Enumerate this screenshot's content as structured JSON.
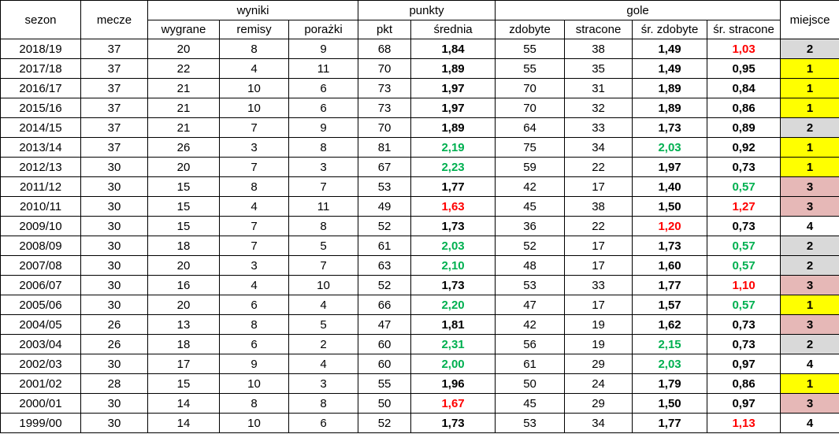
{
  "headers": {
    "sezon": "sezon",
    "mecze": "mecze",
    "wyniki": "wyniki",
    "punkty": "punkty",
    "gole": "gole",
    "miejsce": "miejsce",
    "wygrane": "wygrane",
    "remisy": "remisy",
    "porazki": "porażki",
    "pkt": "pkt",
    "srednia": "średnia",
    "zdobyte": "zdobyte",
    "stracone": "stracone",
    "sr_zdobyte": "śr. zdobyte",
    "sr_stracone": "śr. stracone"
  },
  "colors": {
    "green": "#00b050",
    "red": "#ff0000",
    "place_1": "#ffff00",
    "place_2": "#d9d9d9",
    "place_3": "#e6b8b7",
    "place_4": "#ffffff"
  },
  "rows": [
    {
      "sezon": "2018/19",
      "mecze": "37",
      "wygrane": "20",
      "remisy": "8",
      "porazki": "9",
      "pkt": "68",
      "srednia": "1,84",
      "srednia_color": "",
      "zdobyte": "55",
      "stracone": "38",
      "sr_zdobyte": "1,49",
      "sr_zdobyte_color": "",
      "sr_stracone": "1,03",
      "sr_stracone_color": "red",
      "miejsce": "2"
    },
    {
      "sezon": "2017/18",
      "mecze": "37",
      "wygrane": "22",
      "remisy": "4",
      "porazki": "11",
      "pkt": "70",
      "srednia": "1,89",
      "srednia_color": "",
      "zdobyte": "55",
      "stracone": "35",
      "sr_zdobyte": "1,49",
      "sr_zdobyte_color": "",
      "sr_stracone": "0,95",
      "sr_stracone_color": "",
      "miejsce": "1"
    },
    {
      "sezon": "2016/17",
      "mecze": "37",
      "wygrane": "21",
      "remisy": "10",
      "porazki": "6",
      "pkt": "73",
      "srednia": "1,97",
      "srednia_color": "",
      "zdobyte": "70",
      "stracone": "31",
      "sr_zdobyte": "1,89",
      "sr_zdobyte_color": "",
      "sr_stracone": "0,84",
      "sr_stracone_color": "",
      "miejsce": "1"
    },
    {
      "sezon": "2015/16",
      "mecze": "37",
      "wygrane": "21",
      "remisy": "10",
      "porazki": "6",
      "pkt": "73",
      "srednia": "1,97",
      "srednia_color": "",
      "zdobyte": "70",
      "stracone": "32",
      "sr_zdobyte": "1,89",
      "sr_zdobyte_color": "",
      "sr_stracone": "0,86",
      "sr_stracone_color": "",
      "miejsce": "1"
    },
    {
      "sezon": "2014/15",
      "mecze": "37",
      "wygrane": "21",
      "remisy": "7",
      "porazki": "9",
      "pkt": "70",
      "srednia": "1,89",
      "srednia_color": "",
      "zdobyte": "64",
      "stracone": "33",
      "sr_zdobyte": "1,73",
      "sr_zdobyte_color": "",
      "sr_stracone": "0,89",
      "sr_stracone_color": "",
      "miejsce": "2"
    },
    {
      "sezon": "2013/14",
      "mecze": "37",
      "wygrane": "26",
      "remisy": "3",
      "porazki": "8",
      "pkt": "81",
      "srednia": "2,19",
      "srednia_color": "green",
      "zdobyte": "75",
      "stracone": "34",
      "sr_zdobyte": "2,03",
      "sr_zdobyte_color": "green",
      "sr_stracone": "0,92",
      "sr_stracone_color": "",
      "miejsce": "1"
    },
    {
      "sezon": "2012/13",
      "mecze": "30",
      "wygrane": "20",
      "remisy": "7",
      "porazki": "3",
      "pkt": "67",
      "srednia": "2,23",
      "srednia_color": "green",
      "zdobyte": "59",
      "stracone": "22",
      "sr_zdobyte": "1,97",
      "sr_zdobyte_color": "",
      "sr_stracone": "0,73",
      "sr_stracone_color": "",
      "miejsce": "1"
    },
    {
      "sezon": "2011/12",
      "mecze": "30",
      "wygrane": "15",
      "remisy": "8",
      "porazki": "7",
      "pkt": "53",
      "srednia": "1,77",
      "srednia_color": "",
      "zdobyte": "42",
      "stracone": "17",
      "sr_zdobyte": "1,40",
      "sr_zdobyte_color": "",
      "sr_stracone": "0,57",
      "sr_stracone_color": "green",
      "miejsce": "3"
    },
    {
      "sezon": "2010/11",
      "mecze": "30",
      "wygrane": "15",
      "remisy": "4",
      "porazki": "11",
      "pkt": "49",
      "srednia": "1,63",
      "srednia_color": "red",
      "zdobyte": "45",
      "stracone": "38",
      "sr_zdobyte": "1,50",
      "sr_zdobyte_color": "",
      "sr_stracone": "1,27",
      "sr_stracone_color": "red",
      "miejsce": "3"
    },
    {
      "sezon": "2009/10",
      "mecze": "30",
      "wygrane": "15",
      "remisy": "7",
      "porazki": "8",
      "pkt": "52",
      "srednia": "1,73",
      "srednia_color": "",
      "zdobyte": "36",
      "stracone": "22",
      "sr_zdobyte": "1,20",
      "sr_zdobyte_color": "red",
      "sr_stracone": "0,73",
      "sr_stracone_color": "",
      "miejsce": "4"
    },
    {
      "sezon": "2008/09",
      "mecze": "30",
      "wygrane": "18",
      "remisy": "7",
      "porazki": "5",
      "pkt": "61",
      "srednia": "2,03",
      "srednia_color": "green",
      "zdobyte": "52",
      "stracone": "17",
      "sr_zdobyte": "1,73",
      "sr_zdobyte_color": "",
      "sr_stracone": "0,57",
      "sr_stracone_color": "green",
      "miejsce": "2"
    },
    {
      "sezon": "2007/08",
      "mecze": "30",
      "wygrane": "20",
      "remisy": "3",
      "porazki": "7",
      "pkt": "63",
      "srednia": "2,10",
      "srednia_color": "green",
      "zdobyte": "48",
      "stracone": "17",
      "sr_zdobyte": "1,60",
      "sr_zdobyte_color": "",
      "sr_stracone": "0,57",
      "sr_stracone_color": "green",
      "miejsce": "2"
    },
    {
      "sezon": "2006/07",
      "mecze": "30",
      "wygrane": "16",
      "remisy": "4",
      "porazki": "10",
      "pkt": "52",
      "srednia": "1,73",
      "srednia_color": "",
      "zdobyte": "53",
      "stracone": "33",
      "sr_zdobyte": "1,77",
      "sr_zdobyte_color": "",
      "sr_stracone": "1,10",
      "sr_stracone_color": "red",
      "miejsce": "3"
    },
    {
      "sezon": "2005/06",
      "mecze": "30",
      "wygrane": "20",
      "remisy": "6",
      "porazki": "4",
      "pkt": "66",
      "srednia": "2,20",
      "srednia_color": "green",
      "zdobyte": "47",
      "stracone": "17",
      "sr_zdobyte": "1,57",
      "sr_zdobyte_color": "",
      "sr_stracone": "0,57",
      "sr_stracone_color": "green",
      "miejsce": "1"
    },
    {
      "sezon": "2004/05",
      "mecze": "26",
      "wygrane": "13",
      "remisy": "8",
      "porazki": "5",
      "pkt": "47",
      "srednia": "1,81",
      "srednia_color": "",
      "zdobyte": "42",
      "stracone": "19",
      "sr_zdobyte": "1,62",
      "sr_zdobyte_color": "",
      "sr_stracone": "0,73",
      "sr_stracone_color": "",
      "miejsce": "3"
    },
    {
      "sezon": "2003/04",
      "mecze": "26",
      "wygrane": "18",
      "remisy": "6",
      "porazki": "2",
      "pkt": "60",
      "srednia": "2,31",
      "srednia_color": "green",
      "zdobyte": "56",
      "stracone": "19",
      "sr_zdobyte": "2,15",
      "sr_zdobyte_color": "green",
      "sr_stracone": "0,73",
      "sr_stracone_color": "",
      "miejsce": "2"
    },
    {
      "sezon": "2002/03",
      "mecze": "30",
      "wygrane": "17",
      "remisy": "9",
      "porazki": "4",
      "pkt": "60",
      "srednia": "2,00",
      "srednia_color": "green",
      "zdobyte": "61",
      "stracone": "29",
      "sr_zdobyte": "2,03",
      "sr_zdobyte_color": "green",
      "sr_stracone": "0,97",
      "sr_stracone_color": "",
      "miejsce": "4"
    },
    {
      "sezon": "2001/02",
      "mecze": "28",
      "wygrane": "15",
      "remisy": "10",
      "porazki": "3",
      "pkt": "55",
      "srednia": "1,96",
      "srednia_color": "",
      "zdobyte": "50",
      "stracone": "24",
      "sr_zdobyte": "1,79",
      "sr_zdobyte_color": "",
      "sr_stracone": "0,86",
      "sr_stracone_color": "",
      "miejsce": "1"
    },
    {
      "sezon": "2000/01",
      "mecze": "30",
      "wygrane": "14",
      "remisy": "8",
      "porazki": "8",
      "pkt": "50",
      "srednia": "1,67",
      "srednia_color": "red",
      "zdobyte": "45",
      "stracone": "29",
      "sr_zdobyte": "1,50",
      "sr_zdobyte_color": "",
      "sr_stracone": "0,97",
      "sr_stracone_color": "",
      "miejsce": "3"
    },
    {
      "sezon": "1999/00",
      "mecze": "30",
      "wygrane": "14",
      "remisy": "10",
      "porazki": "6",
      "pkt": "52",
      "srednia": "1,73",
      "srednia_color": "",
      "zdobyte": "53",
      "stracone": "34",
      "sr_zdobyte": "1,77",
      "sr_zdobyte_color": "",
      "sr_stracone": "1,13",
      "sr_stracone_color": "red",
      "miejsce": "4"
    }
  ]
}
